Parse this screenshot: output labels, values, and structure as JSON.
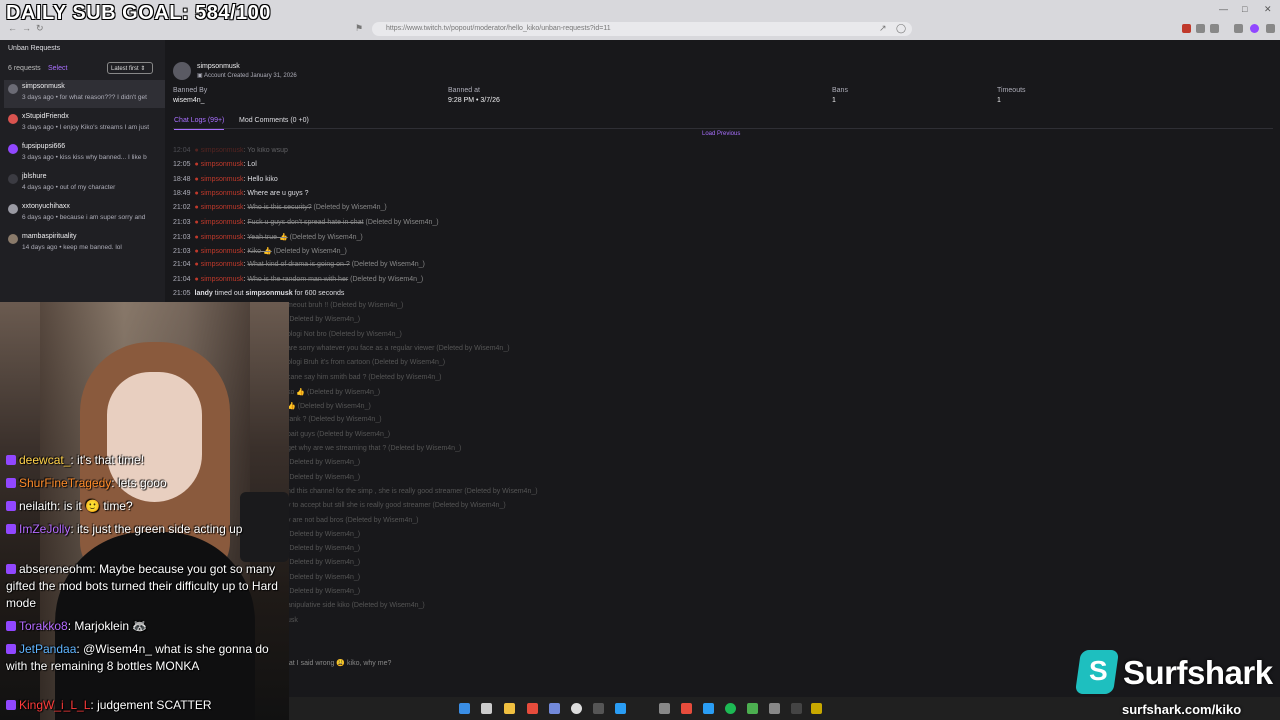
{
  "overlay": {
    "sub_goal": "DAILY SUB GOAL: 584/100"
  },
  "browser": {
    "url": "https://www.twitch.tv/popout/moderator/hello_kiko/unban-requests?id=11"
  },
  "left_panel": {
    "title": "Unban Requests",
    "count": "6 requests",
    "select_label": "Select",
    "sort_label": "Latest first",
    "requests": [
      {
        "name": "simpsonmusk",
        "summary": "3 days ago • for what reason??? I didn't get",
        "avatar_color": "#6b6b75"
      },
      {
        "name": "xStupidFriendx",
        "summary": "3 days ago • I enjoy Kiko's streams I am just",
        "avatar_color": "#d9534f"
      },
      {
        "name": "fupsipupsi666",
        "summary": "3 days ago • kiss kiss why banned... I like b",
        "avatar_color": "#9147ff"
      },
      {
        "name": "jblshure",
        "summary": "4 days ago • out of my character",
        "avatar_color": "#3b3b42"
      },
      {
        "name": "xxtonyuchihaxx",
        "summary": "6 days ago • because i am super sorry and",
        "avatar_color": "#9a9aa3"
      },
      {
        "name": "mambaspirituality",
        "summary": "14 days ago • keep me banned. lol",
        "avatar_color": "#8a7a6a"
      }
    ]
  },
  "detail": {
    "username": "simpsonmusk",
    "account_created": "Account Created January 31, 2026",
    "banned_by_label": "Banned By",
    "banned_by": "wisem4n_",
    "banned_at_label": "Banned at",
    "banned_at": "9:28 PM • 3/7/26",
    "bans_label": "Bans",
    "bans": "1",
    "timeouts_label": "Timeouts",
    "timeouts": "1",
    "tab_chat": "Chat Logs (99+)",
    "tab_mod": "Mod Comments (0 +0)",
    "load_previous": "Load Previous",
    "logs": [
      {
        "time": "12:04",
        "user": "simpsonmusk",
        "msg": "Yo kiko wsup",
        "deleted": false,
        "note": ""
      },
      {
        "time": "12:05",
        "user": "simpsonmusk",
        "msg": "Lol",
        "deleted": false,
        "note": ""
      },
      {
        "time": "18:48",
        "user": "simpsonmusk",
        "msg": "Hello kiko",
        "deleted": false,
        "note": ""
      },
      {
        "time": "18:49",
        "user": "simpsonmusk",
        "msg": "Where are u guys ?",
        "deleted": false,
        "note": ""
      },
      {
        "time": "21:02",
        "user": "simpsonmusk",
        "msg": "Who is this security?",
        "deleted": true,
        "note": "(Deleted by Wisem4n_)"
      },
      {
        "time": "21:03",
        "user": "simpsonmusk",
        "msg": "Fuck u guys don't spread hate in chat",
        "deleted": true,
        "note": "(Deleted by Wisem4n_)"
      },
      {
        "time": "21:03",
        "user": "simpsonmusk",
        "msg": "Yeah true 👍",
        "deleted": true,
        "note": "(Deleted by Wisem4n_)"
      },
      {
        "time": "21:03",
        "user": "simpsonmusk",
        "msg": "Kiko 👍",
        "deleted": true,
        "note": "(Deleted by Wisem4n_)"
      },
      {
        "time": "21:04",
        "user": "simpsonmusk",
        "msg": "What kind of drama is going on ?",
        "deleted": true,
        "note": "(Deleted by Wisem4n_)"
      },
      {
        "time": "21:04",
        "user": "simpsonmusk",
        "msg": "Who is the random man with her",
        "deleted": true,
        "note": "(Deleted by Wisem4n_)"
      }
    ],
    "timeout_line": {
      "time": "21:05",
      "mod": "landy",
      "text": "timed out",
      "user": "simpsonmusk",
      "suffix": "for 600 seconds"
    },
    "hidden_logs": [
      "meout bruh !! (Deleted by Wisem4n_)",
      "(Deleted by Wisem4n_)",
      "ologi  Not bro (Deleted by Wisem4n_)",
      "are sorry whatever you face as a regular viewer (Deleted by Wisem4n_)",
      "ologi  Bruh it's from cartoon (Deleted by Wisem4n_)",
      "cane say him smith bad ? (Deleted by Wisem4n_)",
      "ko 👍 (Deleted by Wisem4n_)",
      "👍 (Deleted by Wisem4n_)",
      "rank ? (Deleted by Wisem4n_)",
      "bait guys (Deleted by Wisem4n_)",
      "get why are we streaming that ? (Deleted by Wisem4n_)",
      "(Deleted by Wisem4n_)",
      "(Deleted by Wisem4n_)",
      "nd this channel for the simp , she is really good streamer (Deleted by Wisem4n_)",
      "y to accept but still she is really good streamer (Deleted by Wisem4n_)",
      "y are not bad bros (Deleted by Wisem4n_)",
      "(Deleted by Wisem4n_)",
      "(Deleted by Wisem4n_)",
      "(Deleted by Wisem4n_)",
      "(Deleted by Wisem4n_)",
      "(Deleted by Wisem4n_)",
      "anipulative side kiko (Deleted by Wisem4n_)",
      "usk"
    ],
    "reply_text": "nat I said wrong 😩 kiko, why me?"
  },
  "stream_chat": [
    {
      "user": "deewcat_",
      "color": "#ffd24a",
      "msg": "it's that time!"
    },
    {
      "user": "ShurFineTragedy",
      "color": "#ff8c2a",
      "msg": "lets gooo"
    },
    {
      "user": "neilaith",
      "color": "#ffffff",
      "msg": "is it 🙂 time?"
    },
    {
      "user": "ImZeJolly",
      "color": "#b46bff",
      "msg": "its just the green side acting up"
    },
    {
      "user": "absereneohm",
      "color": "#ffffff",
      "msg": "Maybe because you got so many gifted the mod bots turned their difficulty up to Hard mode"
    },
    {
      "user": "Torakko8",
      "color": "#b46bff",
      "msg": "Marjoklein 🦝"
    },
    {
      "user": "JetPandaa",
      "color": "#5fb4ff",
      "msg": "@Wisem4n_ what is she gonna do with the remaining 8 bottles MONKA"
    },
    {
      "user": "KingW_i_L_L",
      "color": "#ff3b3b",
      "msg": "judgement SCATTER"
    }
  ],
  "sponsor": {
    "brand": "Surfshark",
    "url": "surfshark.com/kiko",
    "brand_color": "#1ebfbf"
  }
}
